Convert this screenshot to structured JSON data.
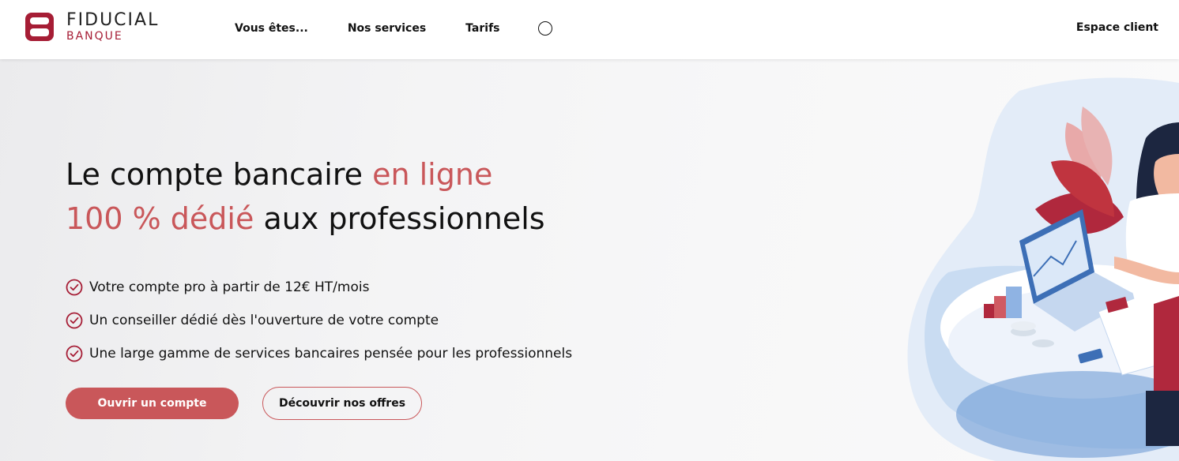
{
  "brand": {
    "name": "FIDUCIAL",
    "sub": "BANQUE",
    "color_primary": "#a61d35",
    "color_accent": "#c9575a"
  },
  "nav": {
    "items": [
      {
        "label": "Vous êtes..."
      },
      {
        "label": "Nos services"
      },
      {
        "label": "Tarifs"
      }
    ],
    "search_icon": "search-icon",
    "espace_client": "Espace client"
  },
  "hero": {
    "title_part1": "Le compte bancaire ",
    "title_accent1": "en ligne",
    "title_accent2": "100 % dédié",
    "title_part2": " aux professionnels",
    "benefits": [
      {
        "text": "Votre compte pro à partir de 12€ HT/mois",
        "icon": "check-circle-icon"
      },
      {
        "text": "Un conseiller dédié dès l'ouverture de votre compte",
        "icon": "check-circle-icon"
      },
      {
        "text": "Une large gamme de services bancaires pensée pour les professionnels",
        "icon": "check-circle-icon"
      }
    ],
    "cta_primary": "Ouvrir un compte",
    "cta_secondary": "Découvrir nos offres"
  }
}
